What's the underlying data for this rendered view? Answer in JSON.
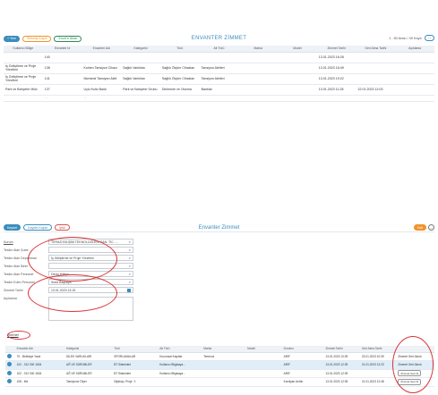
{
  "top": {
    "buttons": {
      "new": "+ Yeni",
      "trash": "Silinmiş Kaydı",
      "excel": "Excel'e Aktar"
    },
    "title": "ENVANTER ZİMMET",
    "pager": "1 - 50 Arası / 49 Kayıt",
    "headers": [
      "Kullanıcı Bölge",
      "Envanter Id",
      "Envanter Adı",
      "Kategorisi",
      "Türü",
      "Alt Türü",
      "Marka",
      "Model",
      "Zimmet Tarihi",
      "Geri Alma Tarihi",
      "Açıklama"
    ],
    "rows": [
      [
        "",
        "140",
        "",
        "",
        "",
        "",
        "",
        "",
        "13.01.2023 16:28",
        "",
        ""
      ],
      [
        "İş Geliştirme ve Proje Yönetimi",
        "138",
        "Kohlen Tansiyon Cihazı",
        "Sağlık Varlıkları",
        "Sağlık Ölçüm Cihazları",
        "Tansiyon Aletleri",
        "",
        "",
        "13.01.2023 16:49",
        "",
        ""
      ],
      [
        "İş Geliştirme ve Proje Yönetimi",
        "141",
        "Mortamlı Tansiyon Aleti",
        "Sağlık Varlıkları",
        "Sağlık Ölçüm Cihazları",
        "Tansiyon Aletleri",
        "",
        "",
        "13.01.2023 19:22",
        "",
        ""
      ],
      [
        "Park ve Bahçeler Müd.",
        "137",
        "Uçlu Kollu Bank",
        "Park ve Bahçeler Grubu",
        "Dinlenme ve Oturma",
        "Banklar",
        "",
        "",
        "13.01.2023 11:28",
        "22.01.2023 12:03",
        ""
      ]
    ],
    "partial_row": [
      "",
      "...",
      "...",
      "",
      "",
      "",
      "",
      "",
      "",
      "",
      ""
    ]
  },
  "bottom": {
    "buttons": {
      "save": "Kaydet",
      "save_close": "Kaydet Kapat",
      "cancel": "İptal"
    },
    "title": "Envanter Zimmet",
    "right": {
      "edit": "Edit"
    },
    "form": {
      "labels": [
        "Kurum",
        "Teslim Alan Şube",
        "Teslim Alan Departman",
        "Teslim Alan Birim",
        "Teslim Alan Personel",
        "Teslim Eden Personel",
        "Zimmet Tarihi",
        "Açıklama"
      ],
      "values": [
        "TERAZİ BİLİŞİM TEKNOLOJİLERİ SAN. TİC. ...",
        "",
        "İş Geliştirme ve Proje Yönetimi",
        "",
        "Deniz Hatipn",
        "Seda Başkaya",
        "13.01.2023 13:15",
        ""
      ]
    },
    "tab": "Zimmet",
    "headers": [
      "",
      "Envanter Adı",
      "Kategorisi",
      "Türü",
      "Alt Türü",
      "Marka",
      "Model",
      "Durumu",
      "Zimmet Tarihi",
      "Geri Alma Tarihi",
      ""
    ],
    "rows": [
      [
        "",
        "70 - Belediye Yanıt",
        "DİLEK VARLIKLARI",
        "SPORLAMALAR",
        "Kurumsal Kayıtlar",
        "Temmuz",
        "",
        "ARIF",
        "13.01.2023 10:39",
        "23.01.2023 10:39",
        "Zimmet Geri Alındı"
      ],
      [
        "",
        "102 - 312 000 1504",
        "AĞ VE SÜRÜMLER",
        "BT Sistemleri",
        "Kullanıcı Bilgisaya...",
        "",
        "",
        "ARIF",
        "13.01.2023 12:39",
        "21.01.2023 12:23",
        "Zimmet Geri Alındı"
      ],
      [
        "",
        "102 - 312 000 1504",
        "AĞ VE SÜRÜMLER",
        "BT Sistemleri",
        "Kullanıcı Bilgisaya...",
        "",
        "",
        "ARIF",
        "13.01.2023 12:39",
        "",
        "Zimmet Geri Al"
      ],
      [
        "",
        "108 - Md",
        "Tansiyone Ölçer",
        "Dijiskop, Proje. Y.",
        "",
        "",
        "",
        "Kordiyan Arıtlık",
        "13.01.2023 12:35",
        "21.01.2023 12:48",
        "Zimmet Geri Al"
      ]
    ]
  }
}
